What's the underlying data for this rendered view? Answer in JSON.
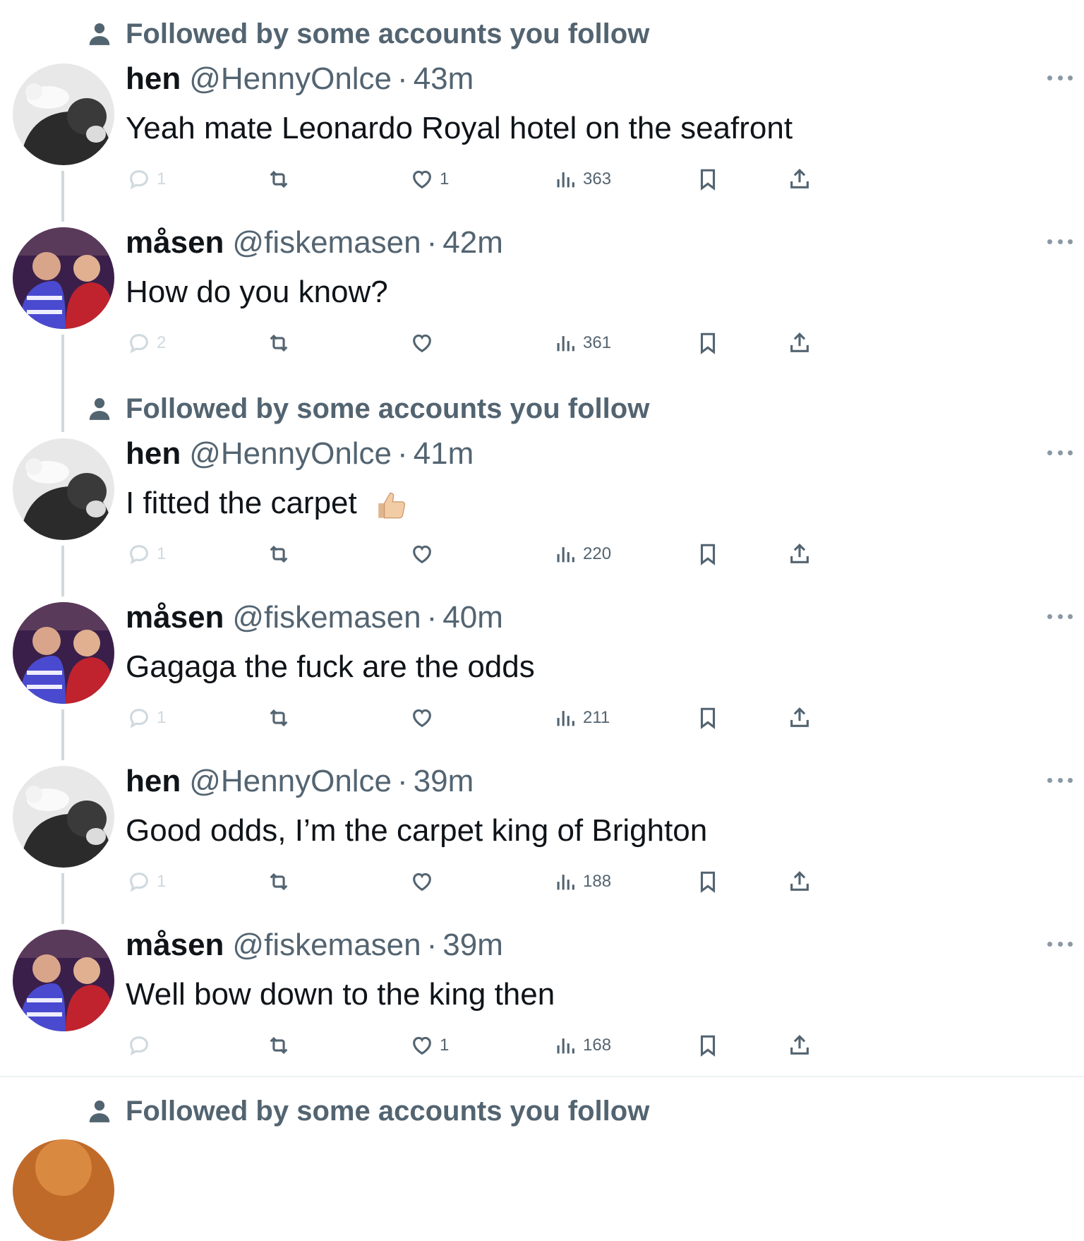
{
  "social_context_label": "Followed by some accounts you follow",
  "tweets": [
    {
      "name": "hen",
      "handle": "@HennyOnlce",
      "time": "43m",
      "text": "Yeah mate Leonardo Royal hotel on the seafront",
      "replies": "1",
      "likes": "1",
      "views": "363"
    },
    {
      "name": "måsen",
      "handle": "@fiskemasen",
      "time": "42m",
      "text": "How do you know?",
      "replies": "2",
      "likes": "",
      "views": "361"
    },
    {
      "name": "hen",
      "handle": "@HennyOnlce",
      "time": "41m",
      "text": "I fitted the carpet",
      "emoji": "thumbs-up",
      "replies": "1",
      "likes": "",
      "views": "220"
    },
    {
      "name": "måsen",
      "handle": "@fiskemasen",
      "time": "40m",
      "text": "Gagaga the fuck are the odds",
      "replies": "1",
      "likes": "",
      "views": "211"
    },
    {
      "name": "hen",
      "handle": "@HennyOnlce",
      "time": "39m",
      "text": "Good odds, I’m the carpet king of Brighton",
      "replies": "1",
      "likes": "",
      "views": "188"
    },
    {
      "name": "måsen",
      "handle": "@fiskemasen",
      "time": "39m",
      "text": "Well bow down to the king then",
      "replies": "",
      "likes": "1",
      "views": "168"
    }
  ],
  "dot_separator": "·",
  "icons": {
    "person": "person-icon",
    "reply": "reply-icon",
    "retweet": "retweet-icon",
    "like": "heart-icon",
    "views": "views-icon",
    "bookmark": "bookmark-icon",
    "share": "share-icon",
    "more": "more-icon"
  },
  "colors": {
    "text": "#0f1419",
    "secondary": "#536471",
    "thread_line": "#cfd9de",
    "divider": "#eff3f4"
  }
}
